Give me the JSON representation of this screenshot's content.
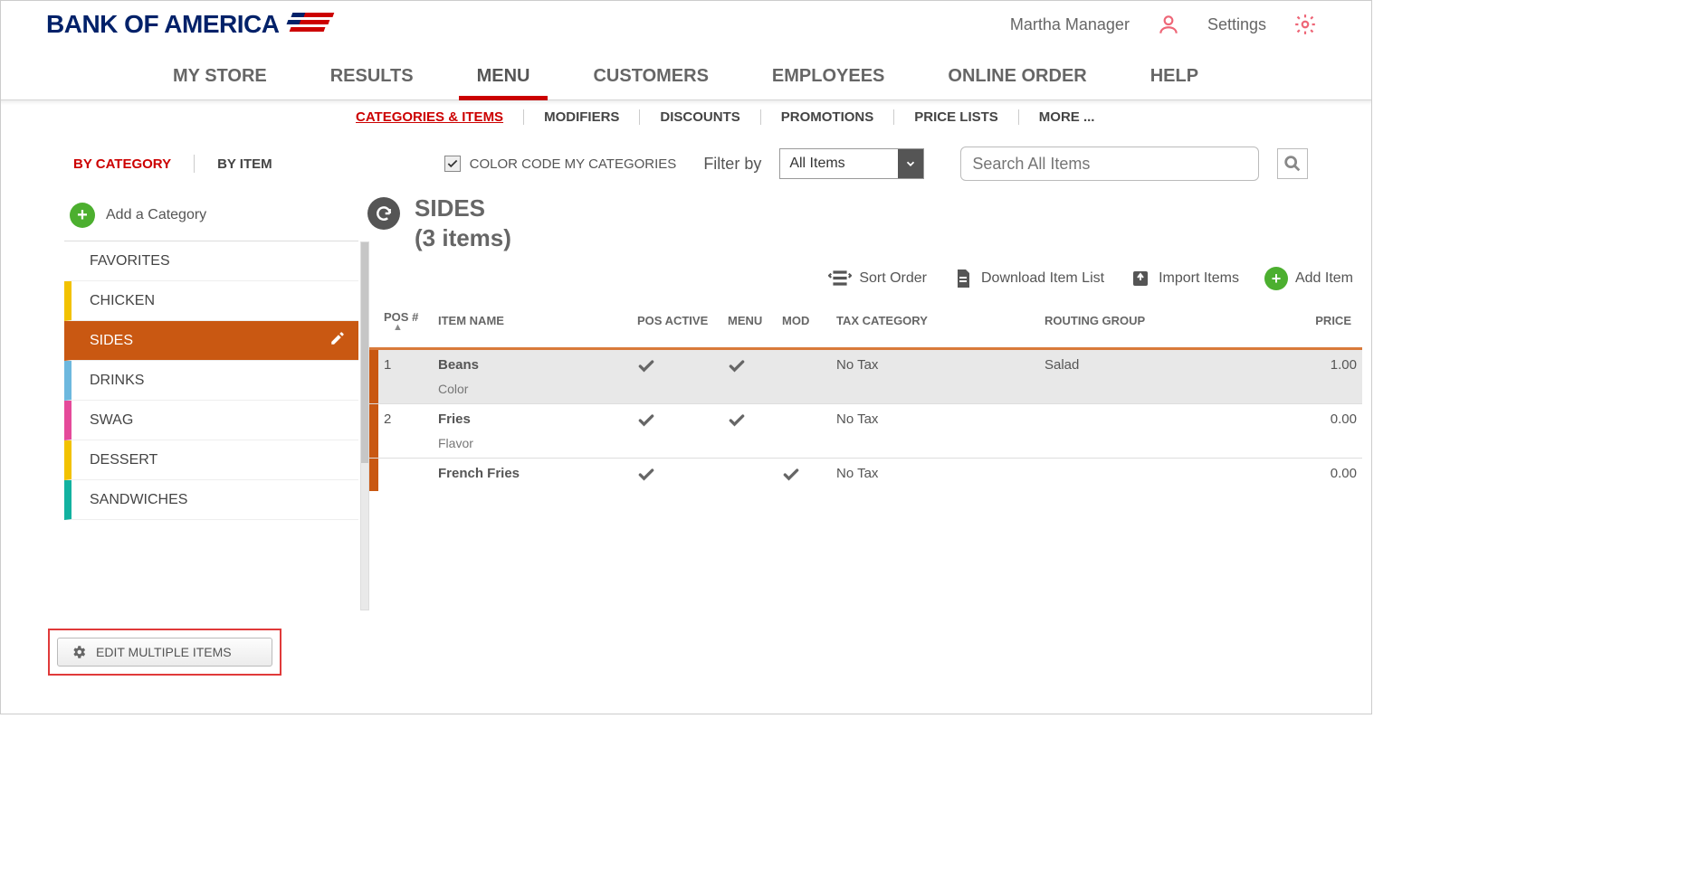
{
  "brand": "BANK OF AMERICA",
  "user": {
    "name": "Martha Manager",
    "settings_label": "Settings"
  },
  "primary_nav": [
    "MY STORE",
    "RESULTS",
    "MENU",
    "CUSTOMERS",
    "EMPLOYEES",
    "ONLINE ORDER",
    "HELP"
  ],
  "primary_nav_active_index": 2,
  "sub_nav": [
    "CATEGORIES & ITEMS",
    "MODIFIERS",
    "DISCOUNTS",
    "PROMOTIONS",
    "PRICE LISTS",
    "MORE ..."
  ],
  "sub_nav_active_index": 0,
  "view_toggle": {
    "by_category": "BY CATEGORY",
    "by_item": "BY ITEM"
  },
  "color_code_label": "COLOR CODE MY CATEGORIES",
  "color_code_checked": true,
  "filter_by_label": "Filter by",
  "filter_select_value": "All Items",
  "search_placeholder": "Search All Items",
  "sidebar": {
    "add_category_label": "Add a Category",
    "categories": [
      {
        "label": "FAVORITES",
        "cls": "fav"
      },
      {
        "label": "CHICKEN",
        "cls": "chicken"
      },
      {
        "label": "SIDES",
        "cls": "sides",
        "active": true
      },
      {
        "label": "DRINKS",
        "cls": "drinks"
      },
      {
        "label": "SWAG",
        "cls": "swag"
      },
      {
        "label": "DESSERT",
        "cls": "dessert"
      },
      {
        "label": "SANDWICHES",
        "cls": "sand"
      }
    ],
    "edit_multiple_label": "EDIT MULTIPLE ITEMS"
  },
  "content": {
    "title_line1": "SIDES",
    "title_line2": "(3 items)",
    "actions": {
      "sort_order": "Sort Order",
      "download": "Download Item List",
      "import": "Import Items",
      "add_item": "Add Item"
    },
    "columns": [
      "POS #",
      "ITEM NAME",
      "POS ACTIVE",
      "MENU",
      "MOD",
      "TAX CATEGORY",
      "ROUTING GROUP",
      "PRICE"
    ],
    "rows": [
      {
        "pos": "1",
        "name": "Beans",
        "sub": "Color",
        "pos_active": true,
        "menu": true,
        "mod": false,
        "tax": "No Tax",
        "routing": "Salad",
        "price": "1.00",
        "sel": true
      },
      {
        "pos": "2",
        "name": "Fries",
        "sub": "Flavor",
        "pos_active": true,
        "menu": true,
        "mod": false,
        "tax": "No Tax",
        "routing": "",
        "price": "0.00",
        "sel": false
      },
      {
        "pos": "",
        "name": "French Fries",
        "sub": "",
        "pos_active": true,
        "menu": false,
        "mod": true,
        "tax": "No Tax",
        "routing": "",
        "price": "0.00",
        "sel": false
      }
    ]
  }
}
